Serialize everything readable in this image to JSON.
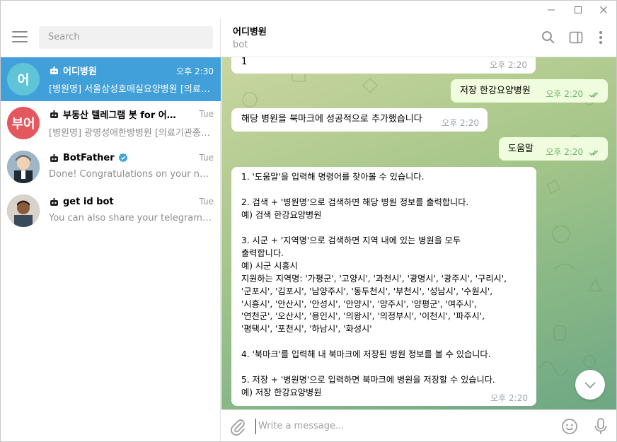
{
  "window": {
    "controls": [
      "minimize",
      "maximize",
      "close"
    ]
  },
  "sidebar": {
    "search_placeholder": "Search",
    "chats": [
      {
        "avatar_text": "어",
        "avatar_color": "#5fc4d8",
        "title": "어디병원",
        "time": "오후 2:30",
        "preview": "[병원명] 서울삼성호매실요양병원  [의료기관종별] 요양병원",
        "active": true
      },
      {
        "avatar_text": "부어",
        "avatar_color": "#e5575f",
        "title": "부동산 텔레그램 봇 for 어디병원",
        "time": "Tue",
        "preview": "[병원명] 광명성애한방병원  [의료기관종별] 한방병원",
        "active": false
      },
      {
        "avatar_text": "",
        "avatar_color": "#6a8fb0",
        "title": "BotFather",
        "time": "Tue",
        "preview": "Done! Congratulations on your new bot. You will find it at",
        "verified": true,
        "active": false
      },
      {
        "avatar_text": "",
        "avatar_color": "#8a6d52",
        "title": "get id bot",
        "time": "Tue",
        "preview": "You can also share your telegram contact",
        "active": false
      }
    ]
  },
  "chat": {
    "peer_name": "어디병원",
    "peer_status": "bot",
    "messages": [
      {
        "dir": "in",
        "text": "1",
        "time": "오후 2:20"
      },
      {
        "dir": "out",
        "text": "저장 한강요양병원",
        "time": "오후 2:20"
      },
      {
        "dir": "in",
        "text": "해당 병원을 북마크에 성공적으로 추가했습니다",
        "time": "오후 2:20"
      },
      {
        "dir": "out",
        "text": "도움말",
        "time": "오후 2:20"
      },
      {
        "dir": "in",
        "text": "1. '도움말'을 입력해 명령어를 찾아볼 수 있습니다.\n\n2. 검색 + '병원명'으로 검색하면 해당 병원 정보를 출력합니다.\n예) 검색 한강요양병원\n\n3. 시군 + '지역명'으로 검색하면 지역 내에 있는 병원을 모두\n출력합니다.\n예) 시군 시흥시\n지원하는 지역명: '가평군', '고양시', '과천시', '광명시', '광주시', '구리시',\n'군포시', '김포시', '남양주시', '동두천시', '부천시', '성남시', '수원시',\n'시흥시', '안산시', '안성시', '안양시', '양주시', '양평군', '여주시',\n'연천군', '오산시', '용인시', '의왕시', '의정부시', '이천시', '파주시',\n'평택시', '포천시', '하남시', '화성시'\n\n4. '북마크'를 입력해 내 북마크에 저장된 병원 정보를 볼 수 있습니다.\n\n5. 저장 + '병원명'으로 입력하면 북마크에 병원을 저장할 수 있습니다.\n예) 저장 한강요양병원",
        "time": "오후 2:20"
      }
    ],
    "composer_placeholder": "Write a message..."
  },
  "colors": {
    "accent": "#419fd9",
    "outgoing_bubble": "#effdde",
    "check": "#6ab36a"
  }
}
